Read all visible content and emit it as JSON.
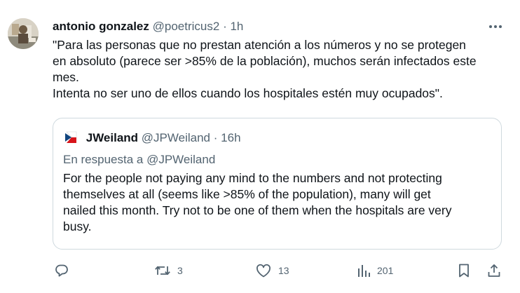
{
  "tweet": {
    "author_name": "antonio gonzalez",
    "author_handle": "@poetricus2",
    "separator": "·",
    "time": "1h",
    "text_lines": [
      "\"Para las personas que no prestan atención a los números y no se protegen",
      "en absoluto (parece ser >85% de la población), muchos serán infectados este",
      "mes.",
      "Intenta no ser uno de ellos cuando los hospitales estén muy ocupados\"."
    ]
  },
  "quoted_tweet": {
    "author_name": "JWeiland",
    "author_handle": "@JPWeiland",
    "separator": "·",
    "time": "16h",
    "reply_to": "En respuesta a @JPWeiland",
    "text_lines": [
      "For the people not paying any mind to the numbers and not protecting",
      "themselves at all (seems like >85% of the population), many will get",
      "nailed this month.  Try not to be one of them when the hospitals are very",
      "busy."
    ]
  },
  "actions": {
    "reply_count": "",
    "retweet_count": "3",
    "like_count": "13",
    "view_count": "201"
  },
  "icons": {
    "more": "more-horizontal-icon",
    "reply": "reply-icon",
    "retweet": "retweet-icon",
    "like": "heart-icon",
    "views": "views-bar-chart-icon",
    "bookmark": "bookmark-icon",
    "share": "share-icon"
  },
  "colors": {
    "primary_text": "#0f1419",
    "secondary_text": "#536471",
    "border": "#cfd9de"
  }
}
